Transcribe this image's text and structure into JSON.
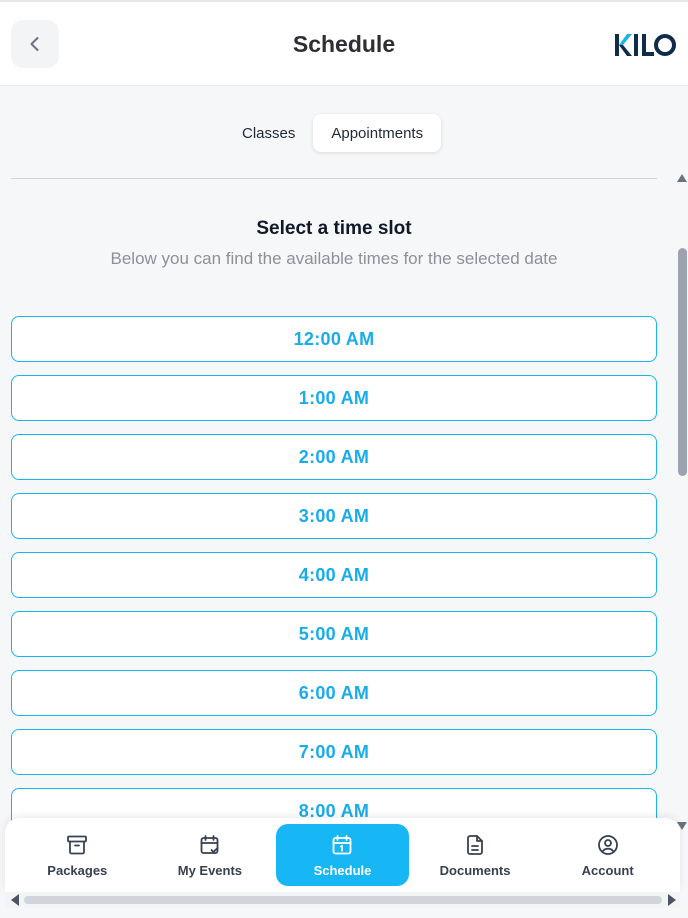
{
  "header": {
    "title": "Schedule",
    "back_icon": "chevron-left-icon",
    "logo_text": "KILO"
  },
  "tabs": [
    {
      "label": "Classes",
      "active": false
    },
    {
      "label": "Appointments",
      "active": true
    }
  ],
  "section": {
    "title": "Select a time slot",
    "subtitle": "Below you can find the available times for the selected date"
  },
  "time_slots": [
    "12:00 AM",
    "1:00 AM",
    "2:00 AM",
    "3:00 AM",
    "4:00 AM",
    "5:00 AM",
    "6:00 AM",
    "7:00 AM",
    "8:00 AM"
  ],
  "bottom_nav": [
    {
      "label": "Packages",
      "icon": "archive-box-icon",
      "active": false
    },
    {
      "label": "My Events",
      "icon": "calendar-check-icon",
      "active": false
    },
    {
      "label": "Schedule",
      "icon": "calendar-icon",
      "active": true
    },
    {
      "label": "Documents",
      "icon": "document-icon",
      "active": false
    },
    {
      "label": "Account",
      "icon": "user-circle-icon",
      "active": false
    }
  ],
  "colors": {
    "accent": "#17b6f5",
    "slot_text": "#19acea",
    "slot_border": "#19b4ee",
    "logo_dark": "#0f2d4a",
    "logo_accent": "#19b4ee"
  }
}
